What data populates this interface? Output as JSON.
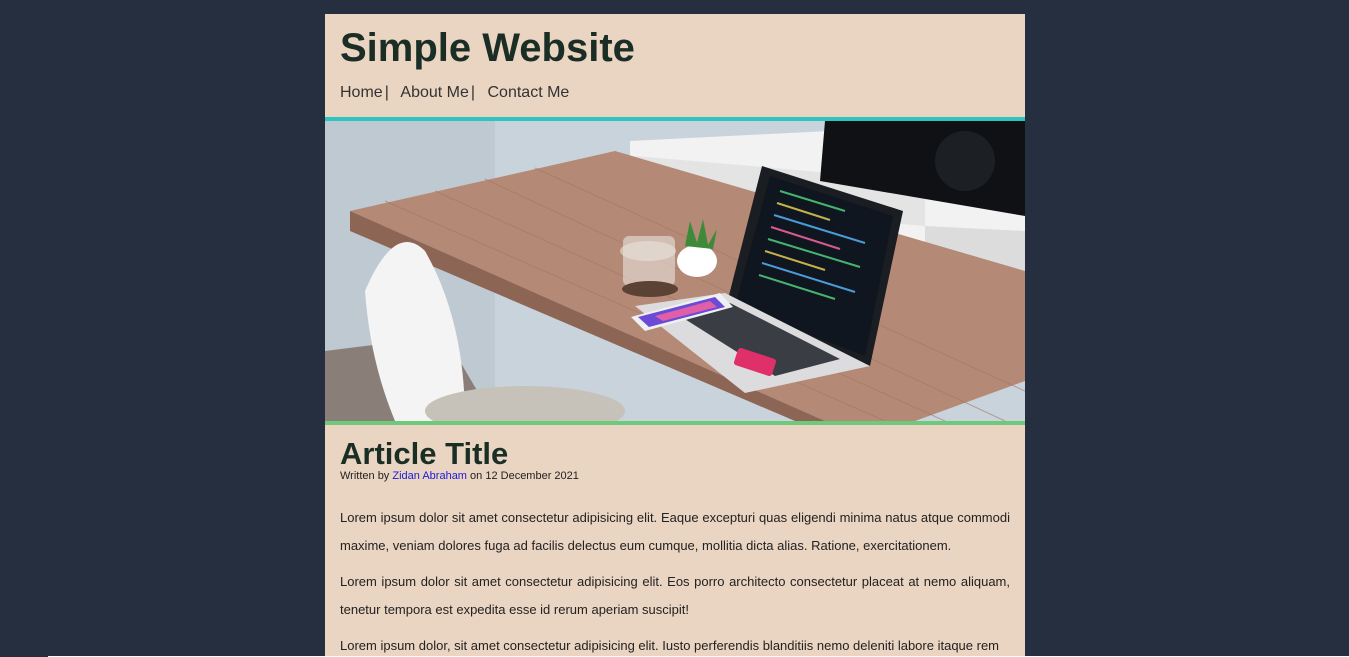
{
  "header": {
    "site_title": "Simple Website",
    "nav": [
      {
        "label": "Home",
        "separator": "|"
      },
      {
        "label": "About Me",
        "separator": "|"
      },
      {
        "label": "Contact Me",
        "separator": ""
      }
    ]
  },
  "hero": {
    "alt": "desk-with-laptop-photo"
  },
  "article": {
    "title": "Article Title",
    "byline_prefix": "Written by",
    "author": "Zidan Abraham",
    "byline_suffix": "on 12 December 2021",
    "paragraphs": [
      "Lorem ipsum dolor sit amet consectetur adipisicing elit. Eaque excepturi quas eligendi minima natus atque commodi maxime, veniam dolores fuga ad facilis delectus eum cumque, mollitia dicta alias. Ratione, exercitationem.",
      "Lorem ipsum dolor sit amet consectetur adipisicing elit. Eos porro architecto consectetur placeat at nemo aliquam, tenetur tempora est expedita esse id rerum aperiam suscipit!",
      "Lorem ipsum dolor, sit amet consectetur adipisicing elit. Iusto perferendis blanditiis nemo deleniti labore itaque rem"
    ]
  },
  "colors": {
    "background": "#252f3f",
    "page": "#ead4c2",
    "header_border": "#2ec4c1",
    "hero_border": "#6fc97a",
    "link": "#1a1ad6"
  }
}
